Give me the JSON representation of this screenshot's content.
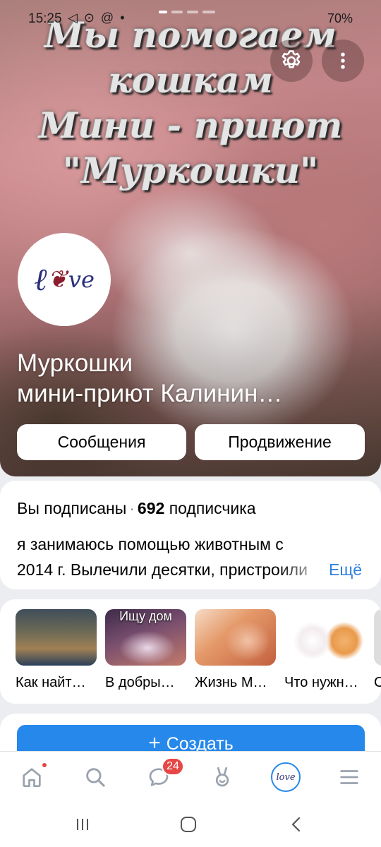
{
  "status_bar": {
    "time": "15:25",
    "left_icons": "◁ ⊙ @ •",
    "right_text": "70%"
  },
  "cover": {
    "caption_lines": [
      "Мы помогаем",
      "кошкам",
      "Мини - приют",
      "\"Муркошки\""
    ],
    "avatar_text": "love",
    "title_line1": "Муркошки",
    "title_line2": "мини-приют Калинин…",
    "messages_label": "Сообщения",
    "promotion_label": "Продвижение",
    "icons": {
      "settings": "gear-icon",
      "more": "more-vertical-icon"
    }
  },
  "info": {
    "subscribed_text": "Вы подписаны",
    "subscriber_count": "692",
    "subscriber_word": "подписчика",
    "description_line1": "я занимаюсь помощью животным с",
    "description_line2": "2014 г. Вылечили десятки, пристроили",
    "more_label": "Ещё"
  },
  "stories": [
    {
      "label": "Как найт…",
      "badge": ""
    },
    {
      "label": "В добры…",
      "badge": "Ищу дом"
    },
    {
      "label": "Жизнь М…",
      "badge": ""
    },
    {
      "label": "Что нужн…",
      "badge": ""
    },
    {
      "label": "С",
      "badge": ""
    }
  ],
  "create": {
    "label": "Создать",
    "plus": "+"
  },
  "tabbar": {
    "messages_badge": "24",
    "avatar_text": "love"
  },
  "colors": {
    "accent": "#2688eb",
    "badge": "#e64646",
    "link": "#2d81e0",
    "background": "#ebedf0"
  }
}
